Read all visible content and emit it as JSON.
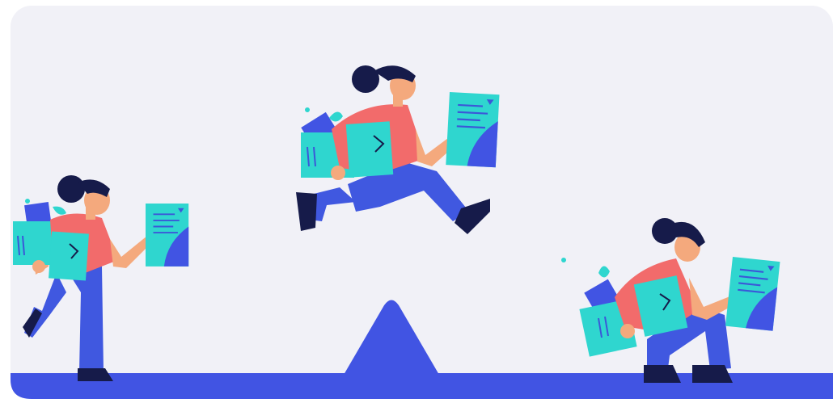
{
  "illustration": {
    "subject": "woman-carrying-documents-jumping-over-seesaw",
    "colors": {
      "background": "#f1f1f7",
      "ground": "#4154e3",
      "shirt": "#f26b6b",
      "pants": "#4058e0",
      "paper": "#2fd6cf",
      "paper_lines": "#3b58d8",
      "hair": "#161b4a",
      "skin": "#f4a97d",
      "shoes": "#161b4a"
    },
    "icons": [
      "document-icon",
      "folder-icon",
      "arrow-icon"
    ]
  }
}
